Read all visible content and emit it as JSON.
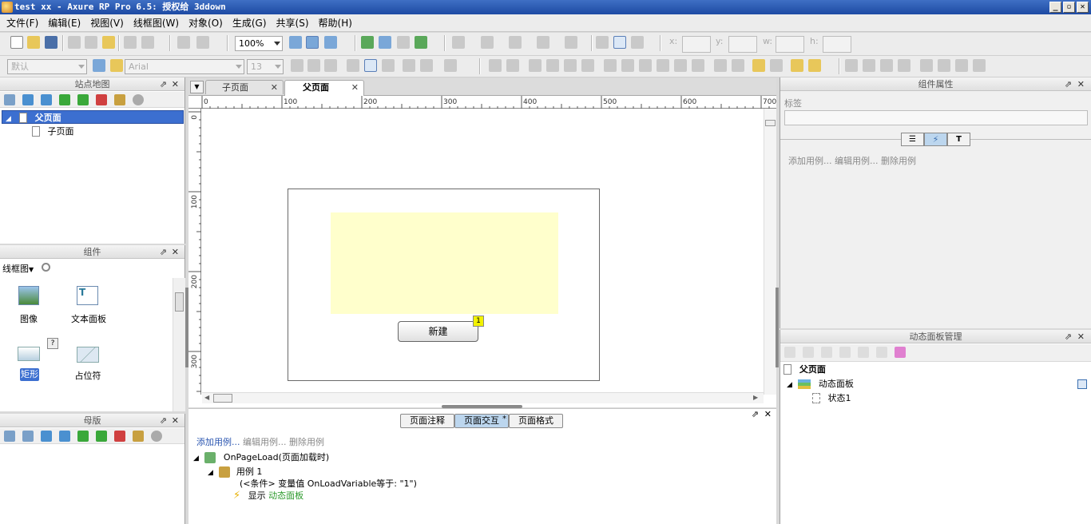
{
  "window": {
    "title": "test xx - Axure RP Pro 6.5: 授权给 3ddown",
    "buttons": [
      "_",
      "▫",
      "✕"
    ]
  },
  "menu": [
    "文件(F)",
    "编辑(E)",
    "视图(V)",
    "线框图(W)",
    "对象(O)",
    "生成(G)",
    "共享(S)",
    "帮助(H)"
  ],
  "toolbar": {
    "zoom": "100%",
    "style_default": "默认",
    "font": "Arial",
    "font_size": "13",
    "coord_labels": [
      "x:",
      "y:",
      "w:",
      "h:"
    ]
  },
  "sitemap": {
    "title": "站点地图",
    "pages": [
      {
        "label": "父页面",
        "selected": true
      },
      {
        "label": "子页面",
        "selected": false
      }
    ]
  },
  "widgets": {
    "title": "组件",
    "library": "线框图",
    "items": [
      {
        "label": "图像"
      },
      {
        "label": "文本面板"
      },
      {
        "label": "矩形",
        "selected": true
      },
      {
        "label": "占位符"
      }
    ],
    "help_badge": "?"
  },
  "masters": {
    "title": "母版"
  },
  "tabs": [
    {
      "label": "子页面",
      "active": false
    },
    {
      "label": "父页面",
      "active": true
    }
  ],
  "ruler": {
    "h_ticks": [
      "0",
      "100",
      "200",
      "300",
      "400",
      "500",
      "600",
      "700"
    ],
    "v_ticks": [
      "0",
      "100",
      "200",
      "300"
    ]
  },
  "canvas": {
    "button_label": "新建",
    "badge": "1"
  },
  "bottom_tabs": [
    "页面注释",
    "页面交互",
    "页面格式"
  ],
  "bottom_tab_marker": "*",
  "interactions": {
    "actions": {
      "add": "添加用例...",
      "edit": "编辑用例...",
      "delete": "删除用例"
    },
    "event": "OnPageLoad(页面加载时)",
    "case": "用例 1",
    "condition": "(<条件> 变量值 OnLoadVariable等于: \"1\")",
    "action_prefix": "显示",
    "action_target": "动态面板"
  },
  "properties": {
    "title": "组件属性",
    "label_caption": "标签",
    "actions": {
      "add": "添加用例...",
      "edit": "编辑用例...",
      "delete": "删除用例"
    }
  },
  "dynamic_panel_manager": {
    "title": "动态面板管理",
    "page": "父页面",
    "panel": "动态面板",
    "state": "状态1"
  }
}
